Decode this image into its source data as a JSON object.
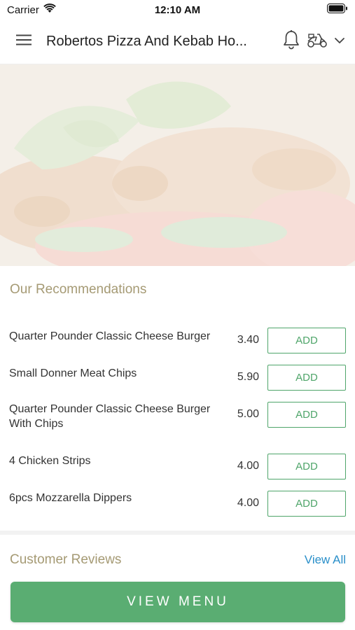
{
  "status_bar": {
    "carrier": "Carrier",
    "time": "12:10 AM"
  },
  "header": {
    "title": "Robertos Pizza And Kebab Ho...",
    "icons": [
      "hamburger-menu-icon",
      "bell-icon",
      "scooter-icon",
      "chevron-down-icon"
    ]
  },
  "recommendations": {
    "title": "Our Recommendations",
    "items": [
      {
        "name": "Quarter Pounder Classic Cheese Burger",
        "price": "3.40",
        "button": "ADD"
      },
      {
        "name": "Small Donner Meat Chips",
        "price": "5.90",
        "button": "ADD"
      },
      {
        "name": "Quarter Pounder Classic Cheese Burger With Chips",
        "price": "5.00",
        "button": "ADD"
      },
      {
        "name": "4 Chicken Strips",
        "price": "4.00",
        "button": "ADD"
      },
      {
        "name": "6pcs Mozzarella Dippers",
        "price": "4.00",
        "button": "ADD"
      }
    ]
  },
  "reviews": {
    "title": "Customer Reviews",
    "view_all": "View All"
  },
  "footer": {
    "view_menu": "VIEW MENU"
  },
  "colors": {
    "accent_green": "#5aad72",
    "section_title": "#a59a74",
    "link_blue": "#2a8fc9"
  }
}
